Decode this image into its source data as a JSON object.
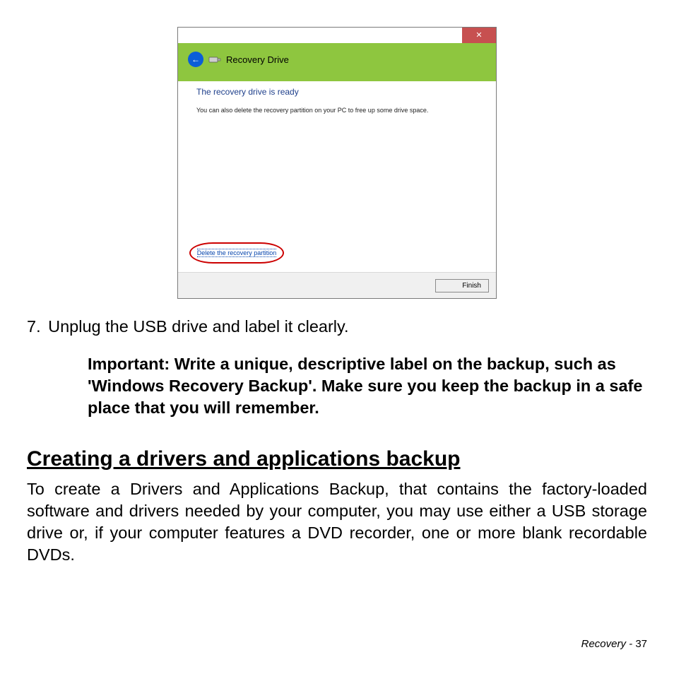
{
  "screenshot": {
    "close_glyph": "✕",
    "back_glyph": "←",
    "drive_icon": "drive-icon",
    "title": "Recovery Drive",
    "ready": "The recovery drive is ready",
    "info": "You can also delete the recovery partition on your PC to free up some drive space.",
    "delete_link": "Delete the recovery partition",
    "finish": "Finish"
  },
  "step": {
    "num": "7.",
    "text": "Unplug the USB drive and label it clearly."
  },
  "important": "Important: Write a unique, descriptive label on the backup, such as 'Windows Recovery Backup'. Make sure you keep the backup in a safe place that you will remember.",
  "section": {
    "title": "Creating a drivers and applications backup",
    "body": "To create a Drivers and Applications Backup, that contains the factory-loaded software and drivers needed by your computer, you may use either a USB storage drive or, if your computer features a DVD recorder, one or more blank recordable DVDs."
  },
  "footer": {
    "section": "Recovery - ",
    "page": "37"
  }
}
